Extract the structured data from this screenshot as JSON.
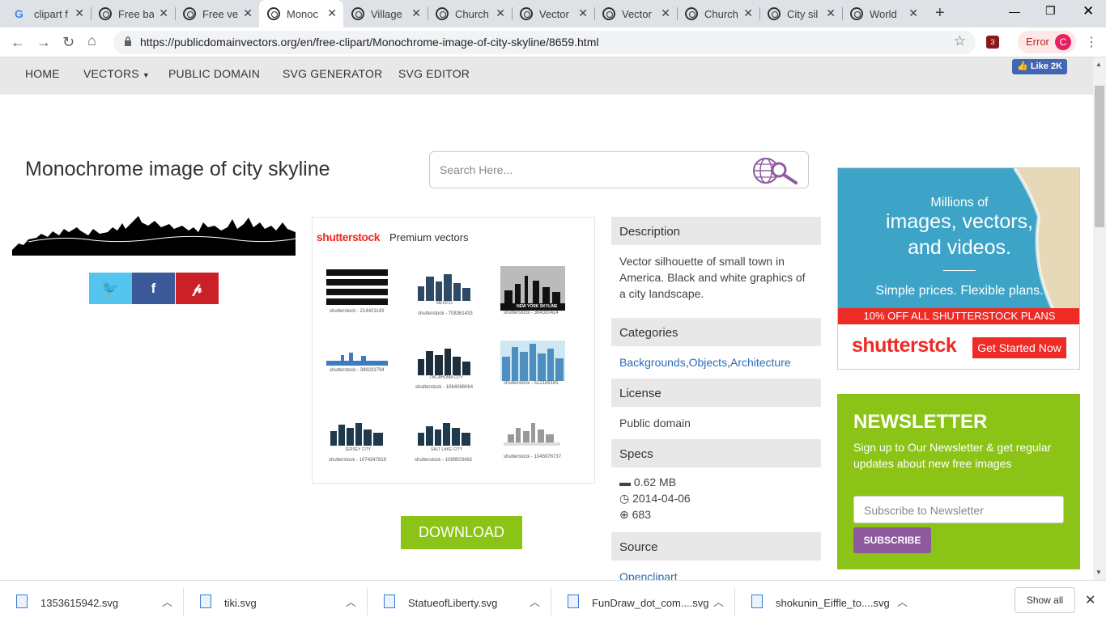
{
  "browser": {
    "tabs": [
      {
        "label": "clipart f",
        "active": false,
        "icon": "google-icon"
      },
      {
        "label": "Free ba",
        "active": false,
        "icon": "pdv-icon"
      },
      {
        "label": "Free ve",
        "active": false,
        "icon": "pdv-icon"
      },
      {
        "label": "Monoc",
        "active": true,
        "icon": "pdv-icon"
      },
      {
        "label": "Village",
        "active": false,
        "icon": "pdv-icon"
      },
      {
        "label": "Church",
        "active": false,
        "icon": "pdv-icon"
      },
      {
        "label": "Vector",
        "active": false,
        "icon": "pdv-icon"
      },
      {
        "label": "Vector",
        "active": false,
        "icon": "pdv-icon"
      },
      {
        "label": "Church",
        "active": false,
        "icon": "pdv-icon"
      },
      {
        "label": "City sil",
        "active": false,
        "icon": "pdv-icon"
      },
      {
        "label": "World",
        "active": false,
        "icon": "pdv-icon"
      }
    ],
    "url": "https://publicdomainvectors.org/en/free-clipart/Monochrome-image-of-city-skyline/8659.html",
    "extension_badge": "3",
    "profile_status": "Error",
    "profile_initial": "C"
  },
  "nav": {
    "items": [
      "HOME",
      "VECTORS",
      "PUBLIC DOMAIN",
      "SVG GENERATOR",
      "SVG EDITOR"
    ],
    "fb_like": "Like 2K"
  },
  "page": {
    "title": "Monochrome image of city skyline",
    "search_placeholder": "Search Here...",
    "download_label": "DOWNLOAD"
  },
  "premium": {
    "brand": "shutterstock",
    "label": "Premium vectors",
    "captions": [
      "shutterstock - 214421143",
      "shutterstock - 708361433",
      "shutterstock - 364330424",
      "shutterstock - 399233794",
      "shutterstock - 1064086064",
      "shutterstock - 512189185",
      "shutterstock - 1074347819",
      "shutterstock - 1089503492",
      "shutterstock - 1045976737"
    ],
    "thumb_texts": [
      "MEXICO",
      "NEW YORK SKYLINE",
      "OKLAHOMA CITY",
      "JERSEY CITY",
      "SALT LAKE CITY"
    ]
  },
  "details": {
    "description_head": "Description",
    "description": "Vector silhouette of small town in America. Black and white graphics of a city landscape.",
    "categories_head": "Categories",
    "categories": [
      "Backgrounds",
      "Objects",
      "Architecture"
    ],
    "license_head": "License",
    "license": "Public domain",
    "specs_head": "Specs",
    "size": "0.62 MB",
    "date": "2014-04-06",
    "downloads": "683",
    "source_head": "Source",
    "source": "Openclipart"
  },
  "ad": {
    "line1": "Millions of",
    "line2": "images, vectors,",
    "line3": "and videos.",
    "line4": "Simple prices. Flexible plans.",
    "banner": "10% OFF ALL SHUTTERSTOCK PLANS",
    "brand": "shutterstck",
    "cta": "Get Started Now"
  },
  "newsletter": {
    "heading": "NEWSLETTER",
    "text": "Sign up to Our Newsletter & get regular updates about new free images",
    "placeholder": "Subscribe to Newsletter",
    "button": "SUBSCRIBE"
  },
  "downloads_bar": {
    "files": [
      "1353615942.svg",
      "tiki.svg",
      "StatueofLiberty.svg",
      "FunDraw_dot_com....svg",
      "shokunin_Eiffle_to....svg"
    ],
    "show_all": "Show all"
  },
  "colors": {
    "accent_green": "#8bc417",
    "link_blue": "#2a6db7",
    "subscribe_purple": "#8e5a9e",
    "shutterstock_red": "#ee2b24"
  }
}
